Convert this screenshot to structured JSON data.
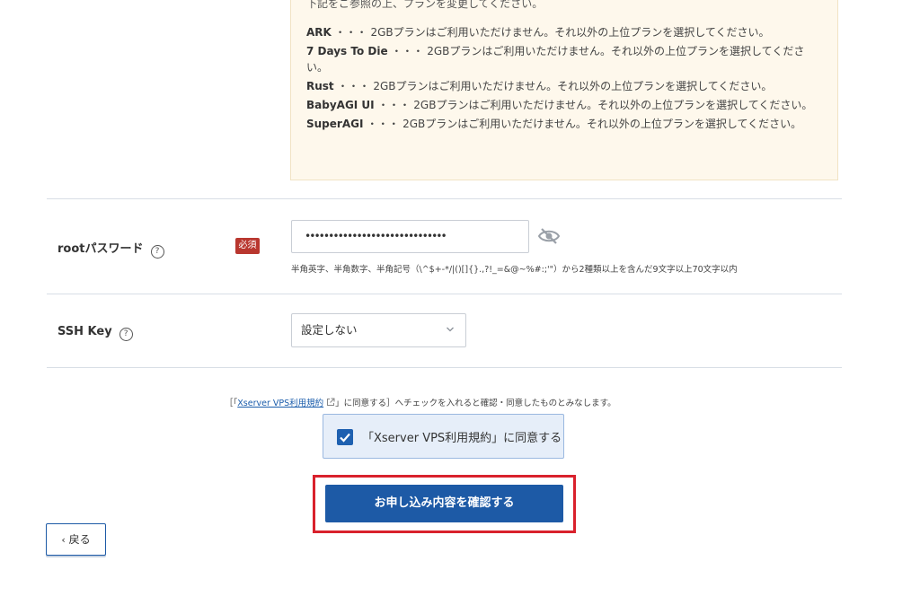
{
  "notice": {
    "top_text": "下記をご参照の上、プランを変更してください。",
    "items": [
      {
        "name": "ARK",
        "text": "・・・ 2GBプランはご利用いただけません。それ以外の上位プランを選択してください。"
      },
      {
        "name": "7 Days To Die",
        "text": "・・・ 2GBプランはご利用いただけません。それ以外の上位プランを選択してください。"
      },
      {
        "name": "Rust",
        "text": "・・・ 2GBプランはご利用いただけません。それ以外の上位プランを選択してください。"
      },
      {
        "name": "BabyAGI UI",
        "text": "・・・ 2GBプランはご利用いただけません。それ以外の上位プランを選択してください。"
      },
      {
        "name": "SuperAGI",
        "text": "・・・ 2GBプランはご利用いただけません。それ以外の上位プランを選択してください。"
      }
    ]
  },
  "root_password": {
    "label": "rootパスワード",
    "help": "?",
    "required_badge": "必須",
    "value": "••••••••••••••••••••••••••••••",
    "hint": "半角英字、半角数字、半角記号（\\^$+-*/|()[]{}.,?!_=&@~%#:;'\"）から2種類以上を含んだ9文字以上70文字以内"
  },
  "ssh_key": {
    "label": "SSH Key",
    "help": "?",
    "selected": "設定しない"
  },
  "terms": {
    "note_prefix": "［「",
    "link_text": "Xserver VPS利用規約",
    "note_suffix": "」に同意する］へチェックを入れると確認・同意したものとみなします。",
    "checkbox_label": "「Xserver VPS利用規約」に同意する",
    "checked": true
  },
  "buttons": {
    "submit": "お申し込み内容を確認する",
    "back": "戻る"
  },
  "colors": {
    "primary": "#1d5aa6",
    "required": "#b9372f",
    "highlight_frame": "#d9212c",
    "notice_bg": "#fef8ec"
  }
}
